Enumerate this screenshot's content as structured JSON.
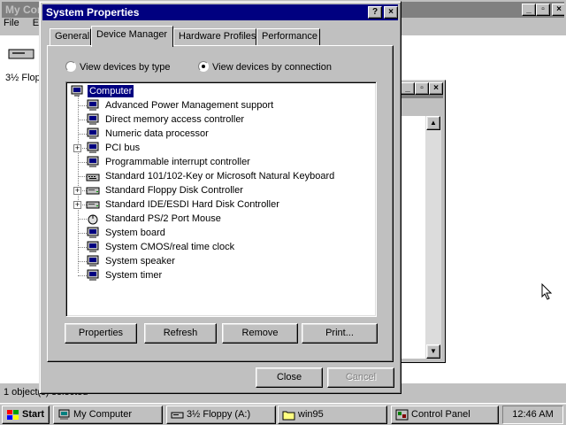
{
  "background_window": {
    "title": "My Computer",
    "menu": [
      "File",
      "Edit"
    ],
    "item_label": "3½ Floppy (A:)",
    "status": "1 object(s) selected"
  },
  "dialog": {
    "title": "System Properties",
    "tabs": [
      "General",
      "Device Manager",
      "Hardware Profiles",
      "Performance"
    ],
    "active_tab": "Device Manager",
    "view_by_type": "View devices by type",
    "view_by_connection": "View devices by connection",
    "selected_view": "connection",
    "tree": {
      "root": "Computer",
      "children": [
        {
          "label": "Advanced Power Management support",
          "icon": "computer-device-icon",
          "expandable": false
        },
        {
          "label": "Direct memory access controller",
          "icon": "computer-device-icon",
          "expandable": false
        },
        {
          "label": "Numeric data processor",
          "icon": "computer-device-icon",
          "expandable": false
        },
        {
          "label": "PCI bus",
          "icon": "computer-device-icon",
          "expandable": true
        },
        {
          "label": "Programmable interrupt controller",
          "icon": "computer-device-icon",
          "expandable": false
        },
        {
          "label": "Standard 101/102-Key or Microsoft Natural Keyboard",
          "icon": "keyboard-icon",
          "expandable": false
        },
        {
          "label": "Standard Floppy Disk Controller",
          "icon": "disk-controller-icon",
          "expandable": true
        },
        {
          "label": "Standard IDE/ESDI Hard Disk Controller",
          "icon": "disk-controller-icon",
          "expandable": true
        },
        {
          "label": "Standard PS/2 Port Mouse",
          "icon": "mouse-icon",
          "expandable": false
        },
        {
          "label": "System board",
          "icon": "computer-device-icon",
          "expandable": false
        },
        {
          "label": "System CMOS/real time clock",
          "icon": "computer-device-icon",
          "expandable": false
        },
        {
          "label": "System speaker",
          "icon": "computer-device-icon",
          "expandable": false
        },
        {
          "label": "System timer",
          "icon": "computer-device-icon",
          "expandable": false
        }
      ]
    },
    "buttons": {
      "properties": "Properties",
      "refresh": "Refresh",
      "remove": "Remove",
      "print": "Print...",
      "close": "Close",
      "cancel": "Cancel"
    }
  },
  "taskbar": {
    "start": "Start",
    "tasks": [
      "My Computer",
      "3½ Floppy (A:)",
      "win95",
      "Control Panel"
    ],
    "clock": "12:46 AM"
  },
  "colors": {
    "face": "#c0c0c0",
    "title_active": "#000080",
    "title_inactive": "#808080",
    "selection": "#000080"
  }
}
